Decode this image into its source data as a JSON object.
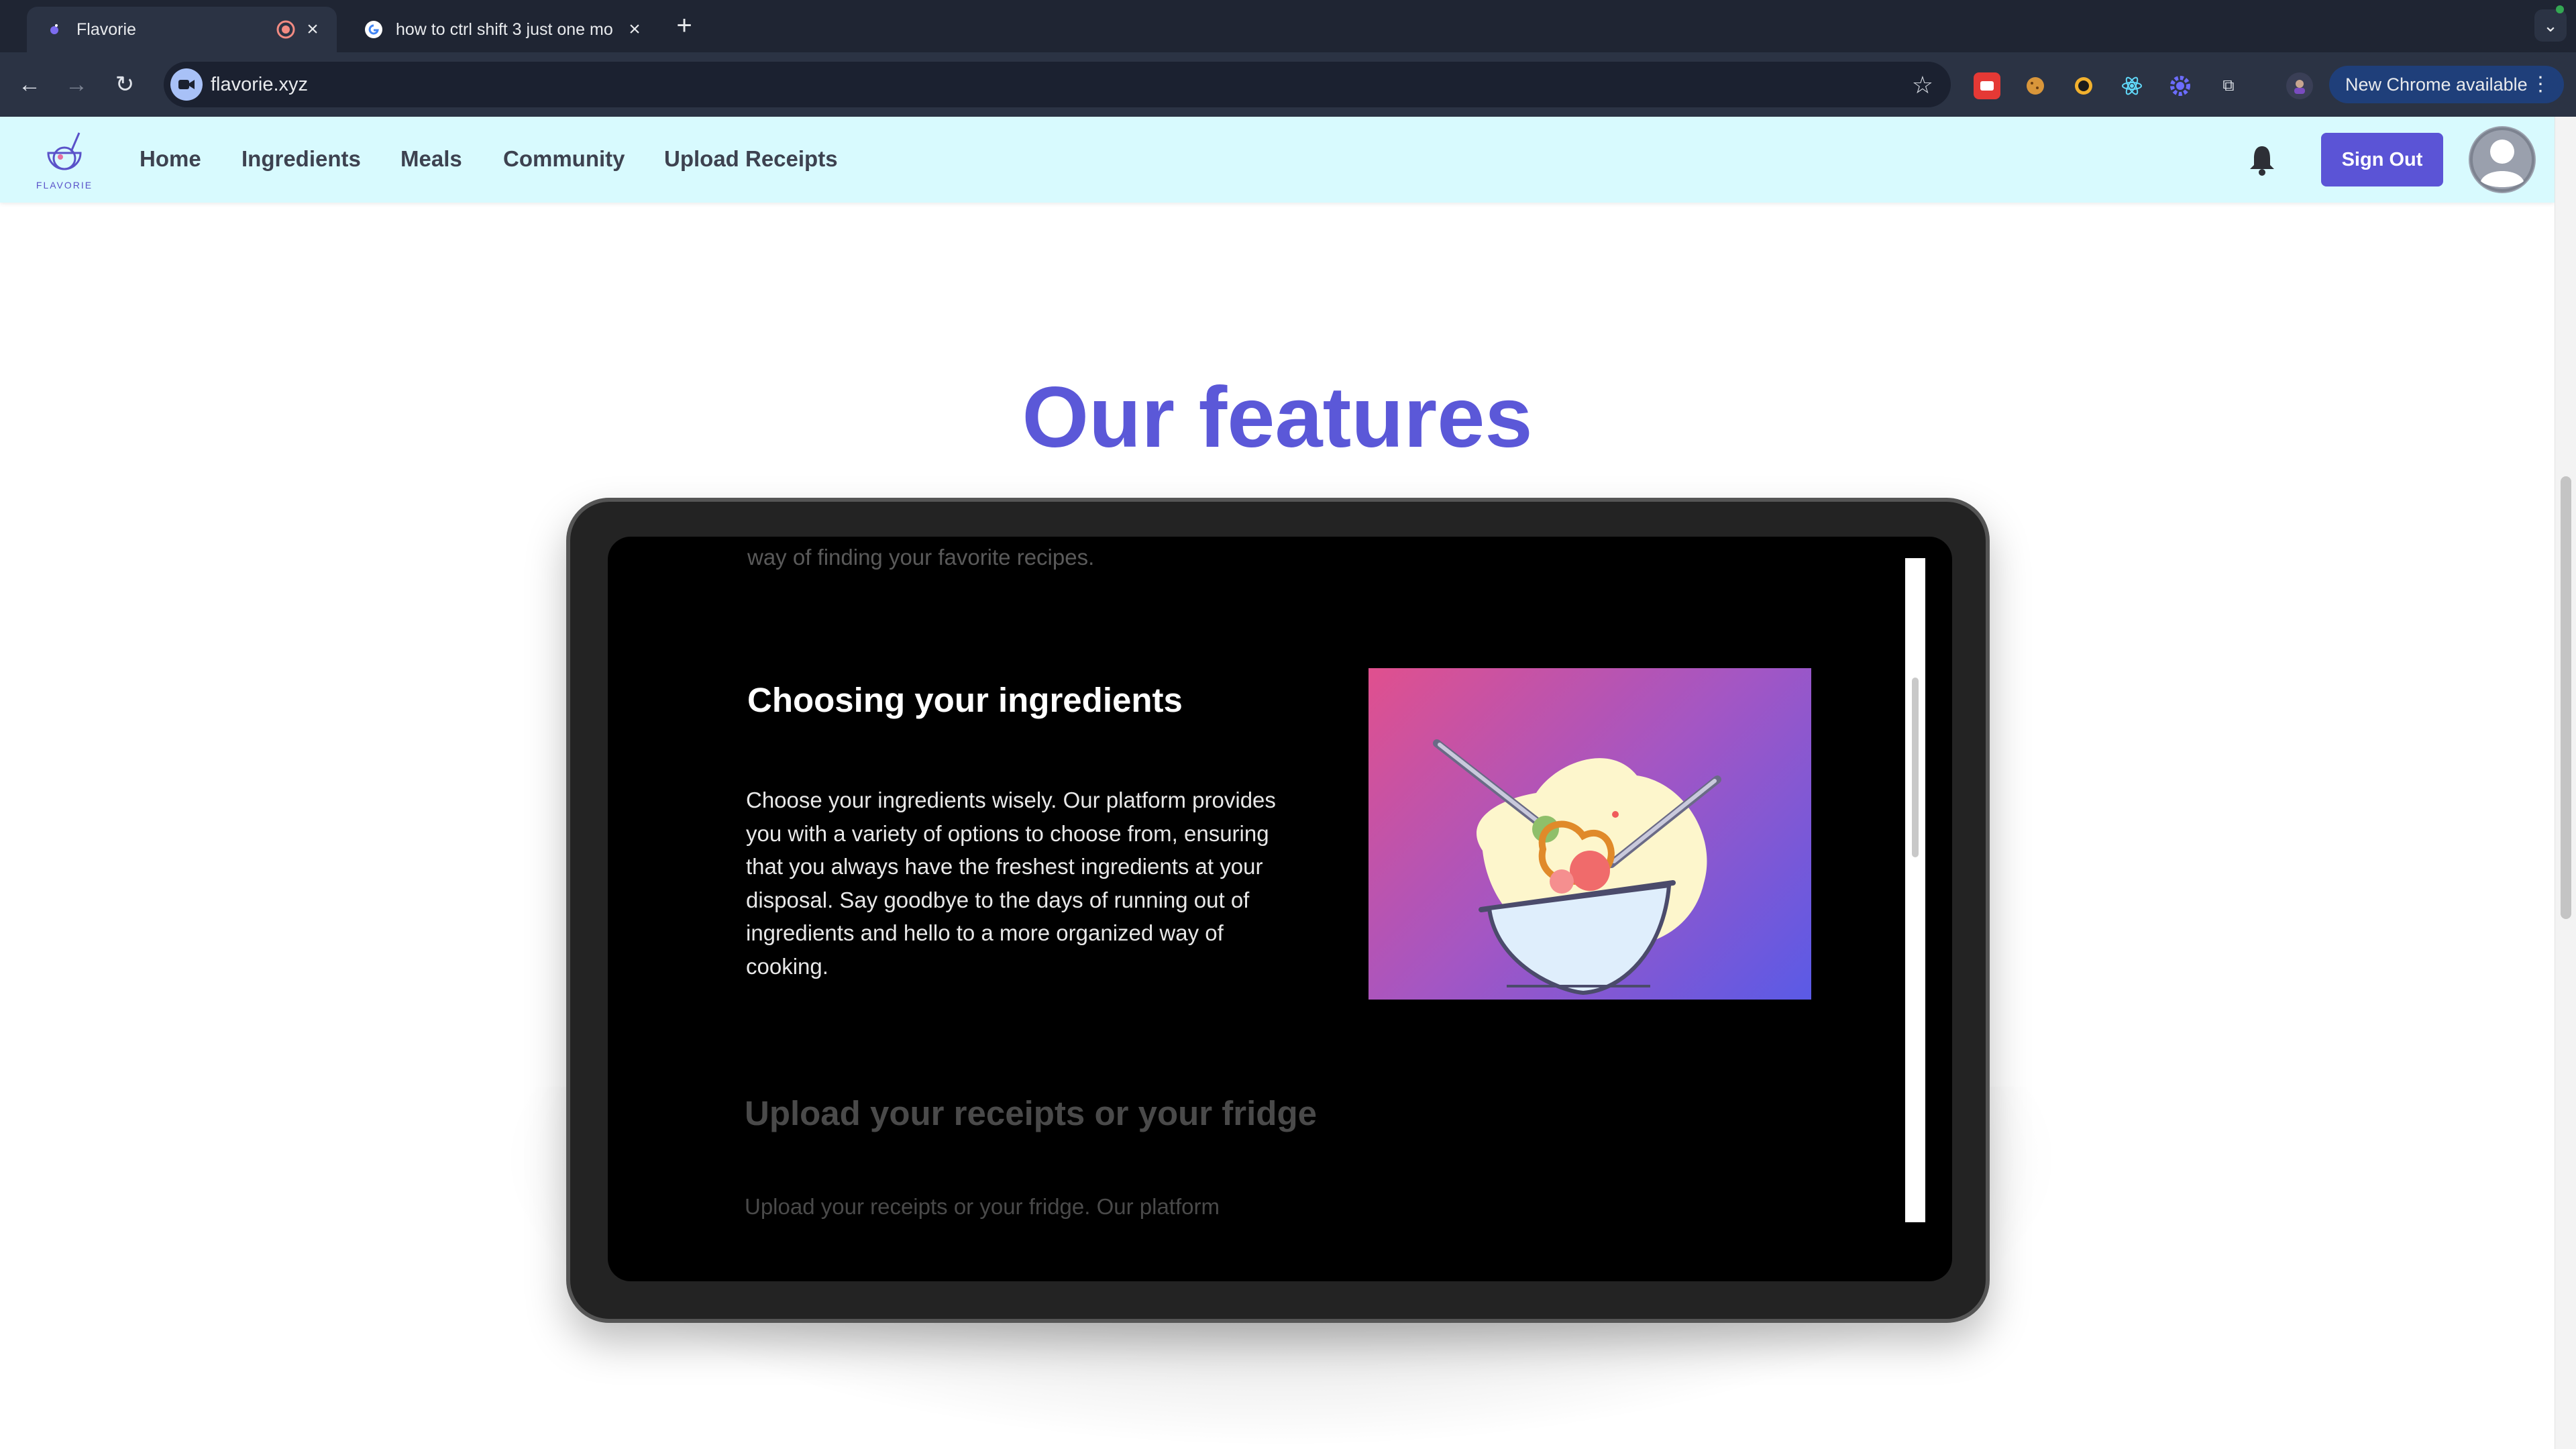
{
  "browser": {
    "tabs": [
      {
        "title": "Flavorie",
        "active": true,
        "recording": true
      },
      {
        "title": "how to ctrl shift 3 just one mo",
        "active": false
      }
    ],
    "url": "flavorie.xyz",
    "update_label": "New Chrome available"
  },
  "header": {
    "brand": "FLAVORIE",
    "nav": [
      "Home",
      "Ingredients",
      "Meals",
      "Community",
      "Upload Receipts"
    ],
    "sign_out_label": "Sign Out"
  },
  "main": {
    "section_title": "Our features",
    "previous_feature_tail": "way of finding your favorite recipes.",
    "current_feature": {
      "title": "Choosing your ingredients",
      "description": "Choose your ingredients wisely. Our platform provides you with a variety of options to choose from, ensuring that you always have the freshest ingredients at your disposal. Say goodbye to the days of running out of ingredients and hello to a more organized way of cooking."
    },
    "next_feature": {
      "title": "Upload your receipts or your fridge",
      "description_preview": "Upload your receipts or your fridge. Our platform"
    }
  },
  "colors": {
    "accent": "#5b54d6",
    "header_bg": "#d8fafe",
    "title": "#5b58d8"
  }
}
